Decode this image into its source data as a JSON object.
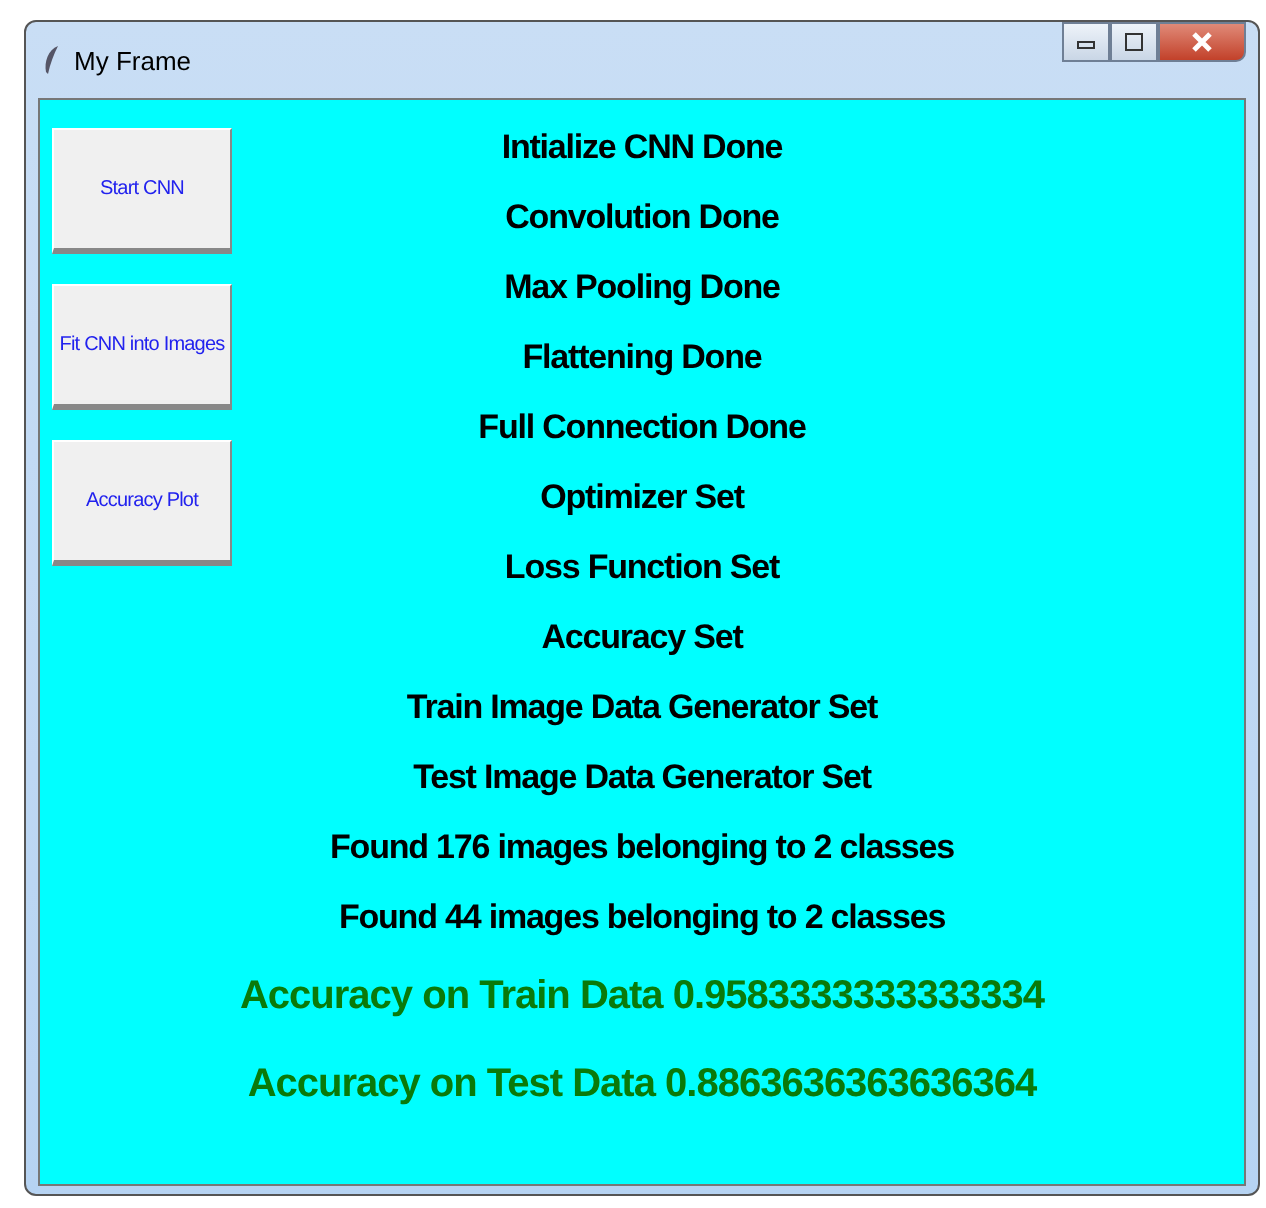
{
  "window": {
    "title": "My Frame"
  },
  "buttons": [
    "Start CNN",
    "Fit CNN into Images",
    "Accuracy Plot"
  ],
  "messages": [
    {
      "kind": "status",
      "text": "Intialize CNN Done"
    },
    {
      "kind": "status",
      "text": "Convolution Done"
    },
    {
      "kind": "status",
      "text": "Max Pooling Done"
    },
    {
      "kind": "status",
      "text": "Flattening Done"
    },
    {
      "kind": "status",
      "text": "Full Connection Done"
    },
    {
      "kind": "status",
      "text": "Optimizer Set"
    },
    {
      "kind": "status",
      "text": "Loss Function Set"
    },
    {
      "kind": "status",
      "text": "Accuracy Set"
    },
    {
      "kind": "status",
      "text": "Train Image Data Generator Set"
    },
    {
      "kind": "status",
      "text": "Test Image Data Generator Set"
    },
    {
      "kind": "status",
      "text": "Found 176 images belonging to 2 classes"
    },
    {
      "kind": "status",
      "text": "Found 44 images belonging to 2 classes"
    },
    {
      "kind": "result",
      "text": "Accuracy on Train Data 0.9583333333333334"
    },
    {
      "kind": "result",
      "text": "Accuracy on Test Data 0.8863636363636364"
    }
  ]
}
